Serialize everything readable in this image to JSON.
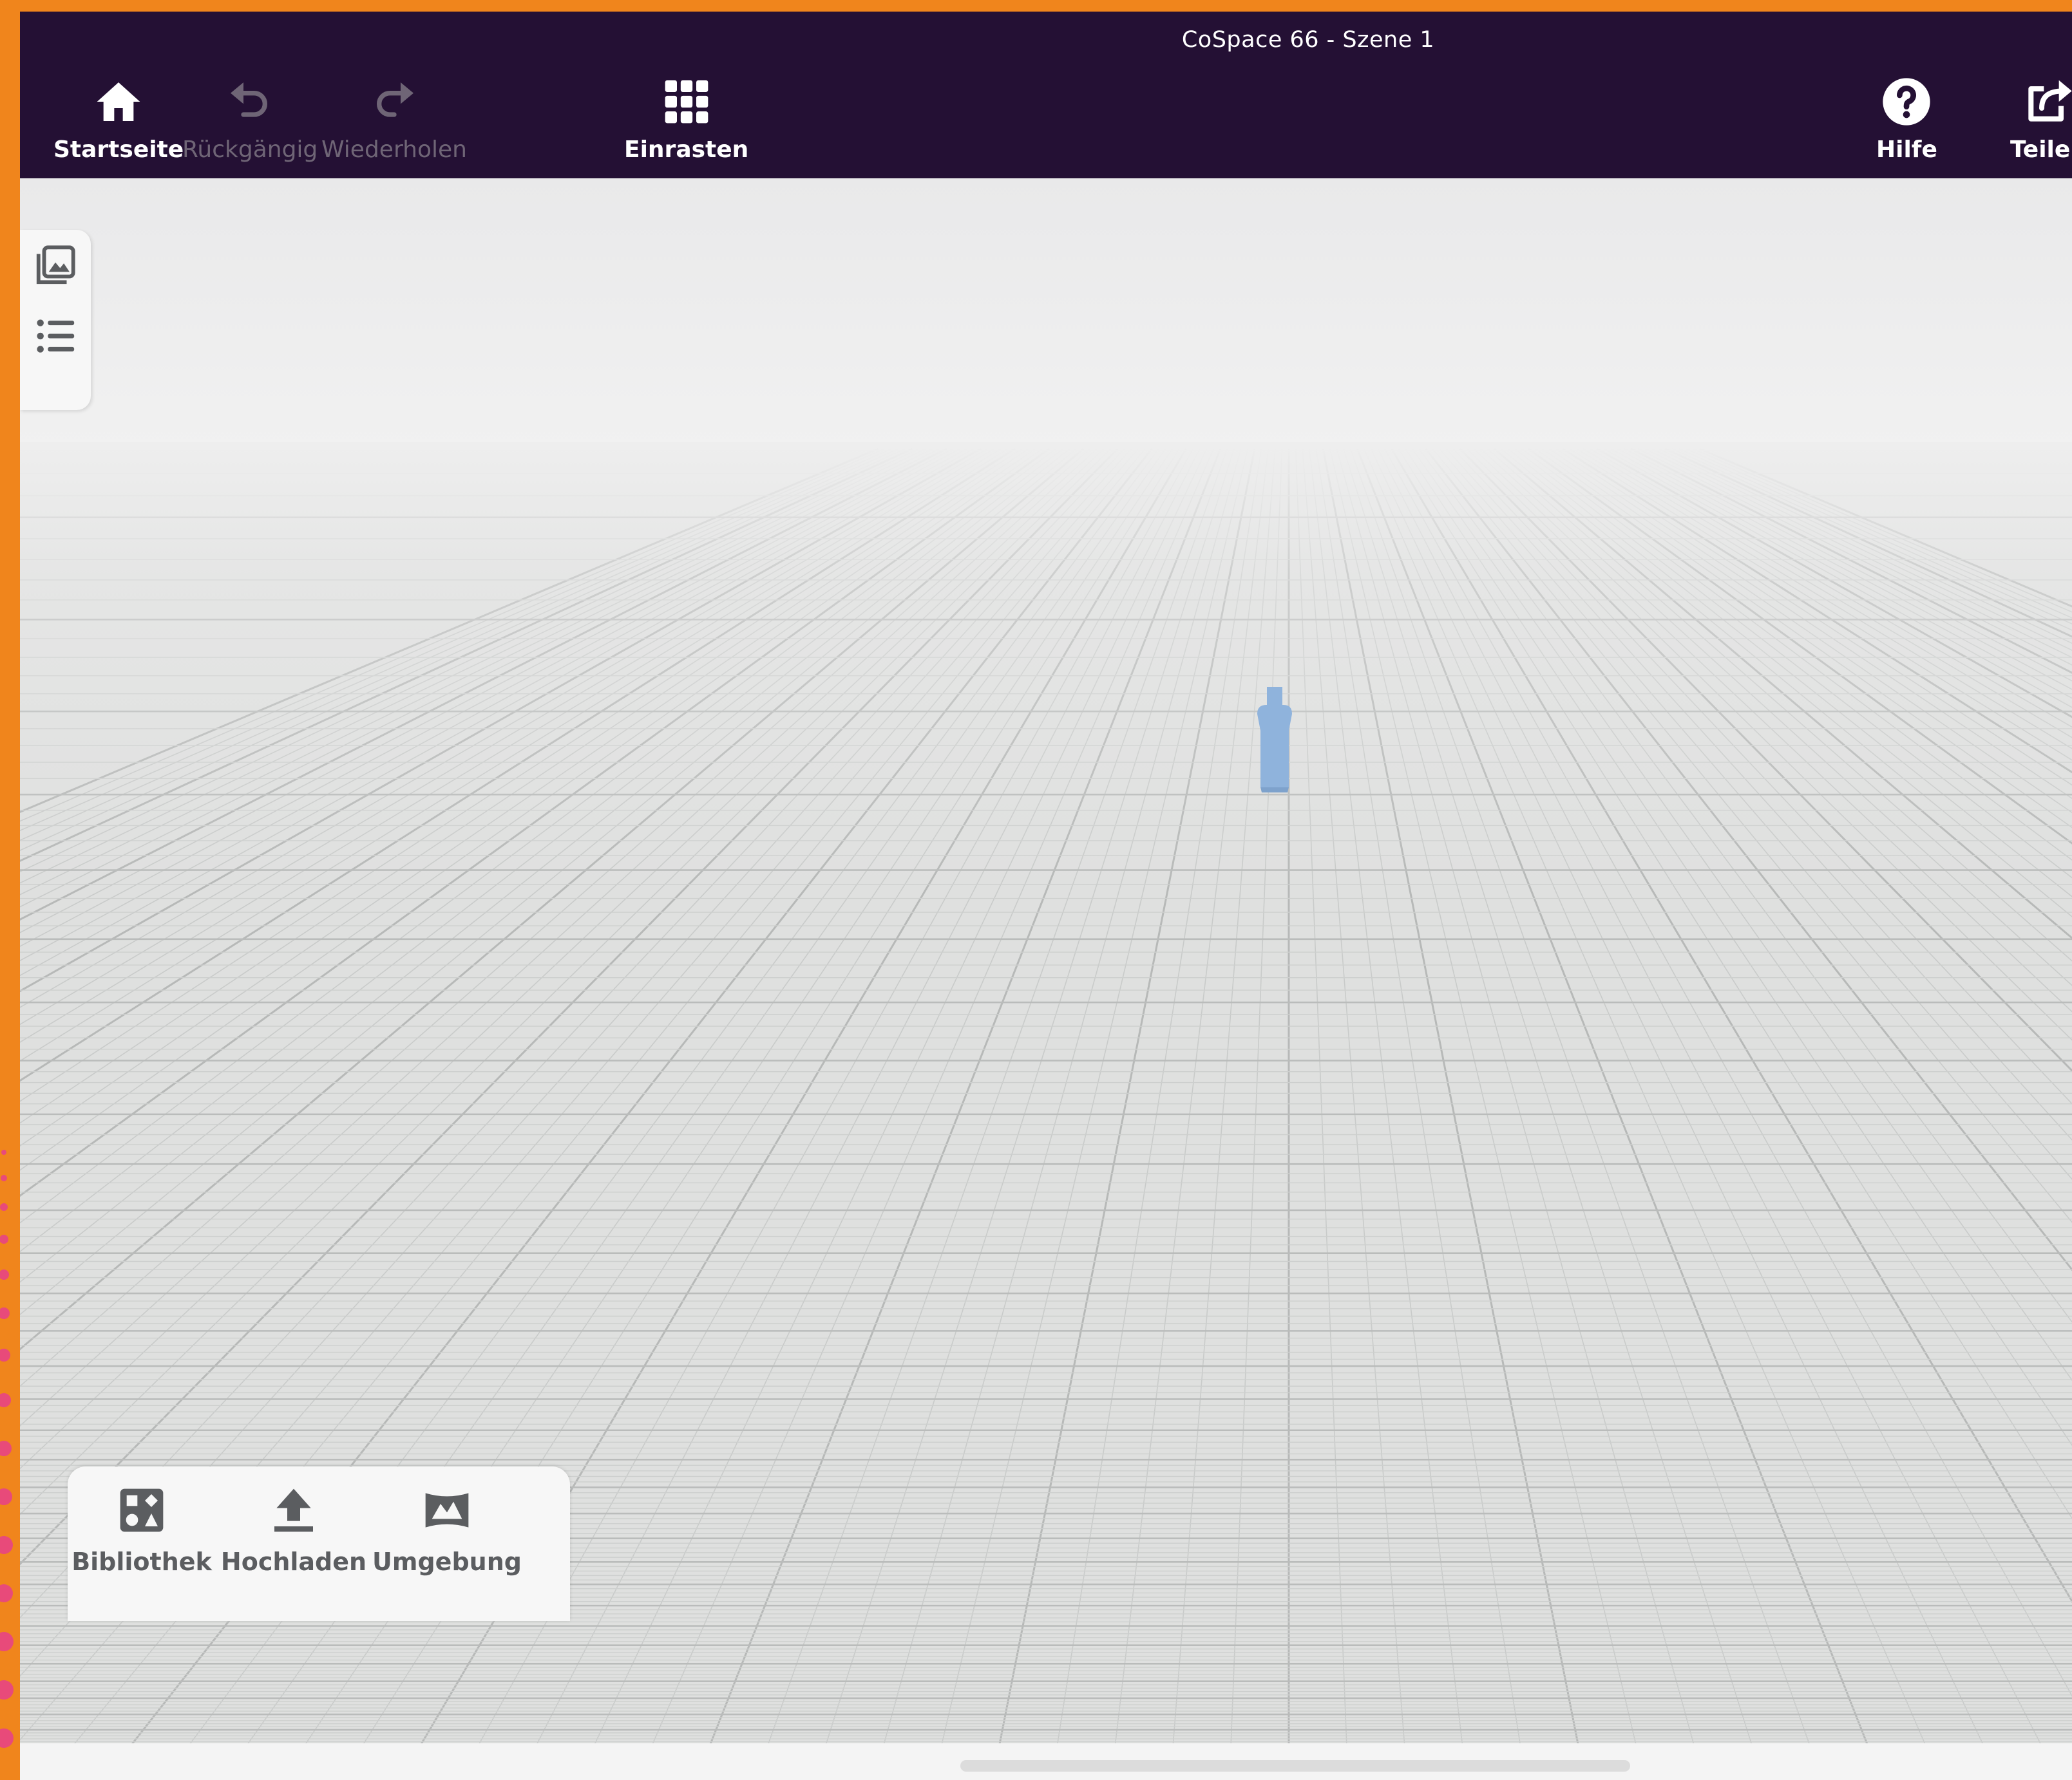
{
  "window": {
    "title": "CoSpace 66 - Szene 1"
  },
  "toolbar": {
    "home": {
      "label": "Startseite",
      "icon": "home-icon"
    },
    "undo": {
      "label": "Rückgängig",
      "icon": "undo-icon",
      "enabled": false
    },
    "redo": {
      "label": "Wiederholen",
      "icon": "redo-icon",
      "enabled": false
    },
    "snap": {
      "label": "Einrasten",
      "icon": "grid-icon"
    },
    "help": {
      "label": "Hilfe",
      "icon": "help-icon"
    },
    "share": {
      "label": "Teilen",
      "icon": "share-icon"
    }
  },
  "side_panel": {
    "items": [
      {
        "icon": "gallery-icon"
      },
      {
        "icon": "list-icon"
      }
    ]
  },
  "bottom_panel": {
    "items": [
      {
        "label": "Bibliothek",
        "icon": "library-icon"
      },
      {
        "label": "Hochladen",
        "icon": "upload-icon"
      },
      {
        "label": "Umgebung",
        "icon": "environment-icon"
      }
    ]
  },
  "colors": {
    "toolbar_bg": "#241034",
    "frame_border": "#f0851c",
    "scene_floor": "#dfe0df",
    "scene_sky": "#eeeeee",
    "figure": "#8fb3dc",
    "disabled_text": "#6f6576"
  }
}
